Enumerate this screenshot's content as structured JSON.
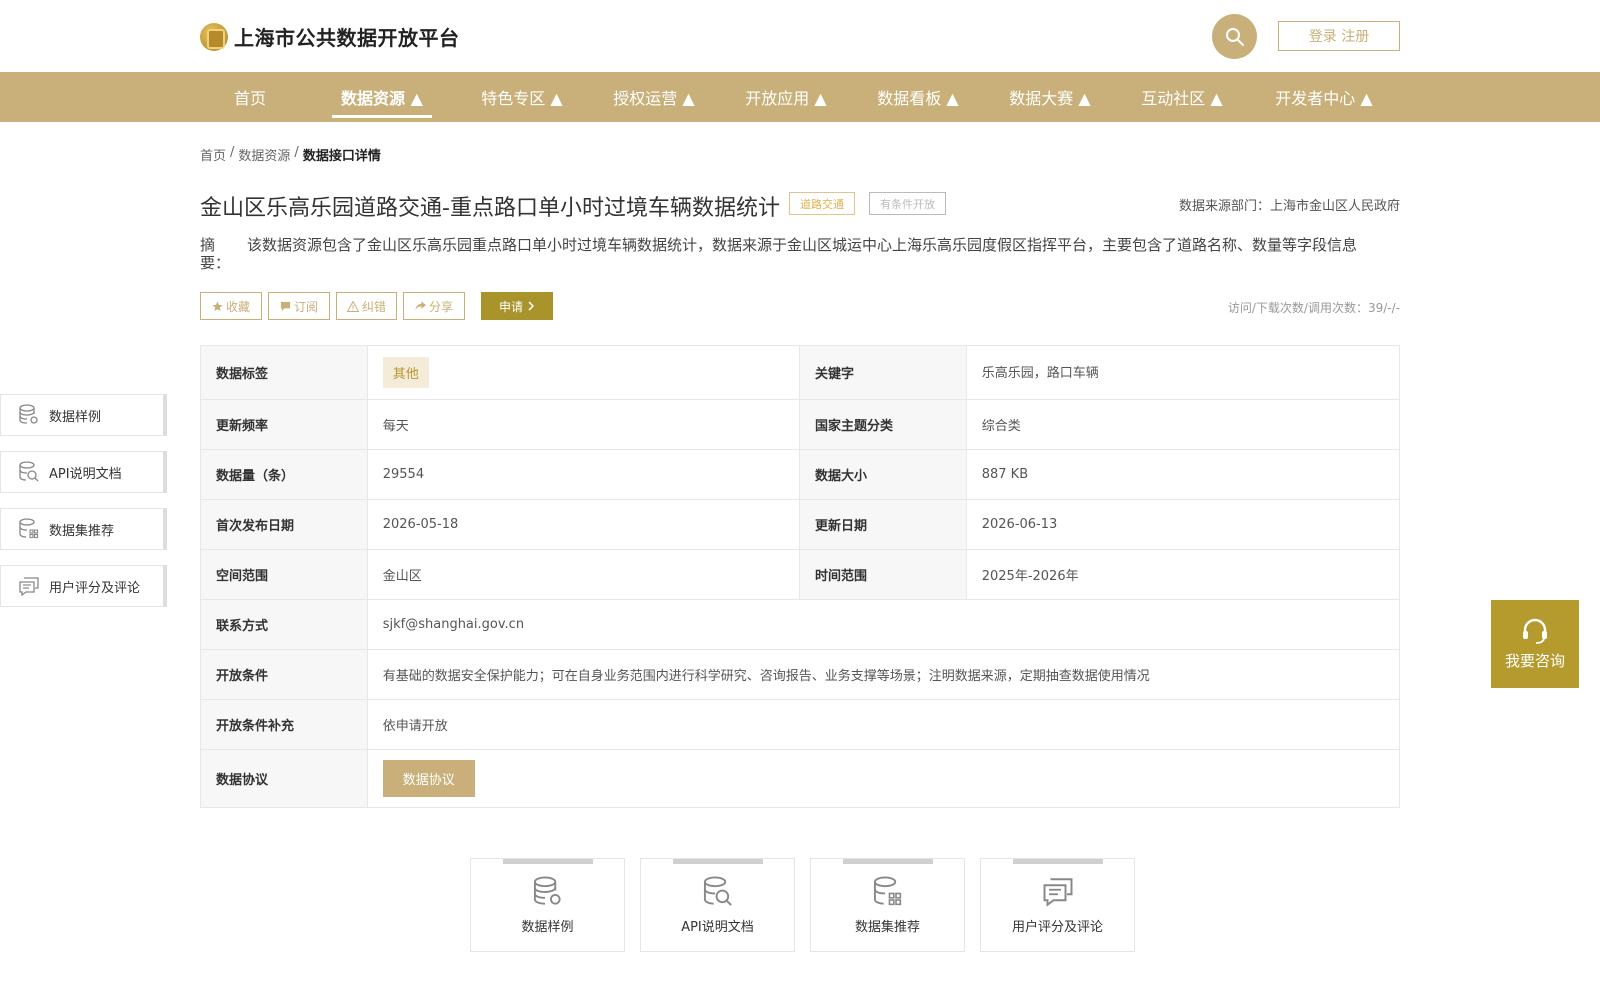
{
  "header": {
    "logo_text": "上海市公共数据开放平台",
    "login_label": "登录 注册"
  },
  "nav": {
    "items": [
      {
        "label": "首页"
      },
      {
        "label": "数据资源 ▲"
      },
      {
        "label": "特色专区 ▲"
      },
      {
        "label": "授权运营 ▲"
      },
      {
        "label": "开放应用 ▲"
      },
      {
        "label": "数据看板 ▲"
      },
      {
        "label": "数据大赛 ▲"
      },
      {
        "label": "互动社区 ▲"
      },
      {
        "label": "开发者中心 ▲"
      }
    ],
    "active_index": 1
  },
  "breadcrumb": {
    "home": "首页",
    "sep": "/",
    "resources": "数据资源",
    "current": "数据接口详情"
  },
  "dataset": {
    "title": "金山区乐高乐园道路交通-重点路口单小时过境车辆数据统计",
    "tag_category": "道路交通",
    "tag_open": "有条件开放",
    "source": "数据来源部门：上海市金山区人民政府",
    "abstract_label": "摘　要：",
    "abstract": "该数据资源包含了金山区乐高乐园重点路口单小时过境车辆数据统计，数据来源于金山区城运中心上海乐高乐园度假区指挥平台，主要包含了道路名称、数量等字段信息"
  },
  "actions": {
    "favorite": "收藏",
    "subscribe": "订阅",
    "report": "纠错",
    "share": "分享",
    "apply": "申请",
    "visits": "访问/下载次数/调用次数：39/-/-"
  },
  "table": {
    "r1": {
      "l1": "数据标签",
      "v1": "其他",
      "l2": "关键字",
      "v2": "乐高乐园，路口车辆"
    },
    "r2": {
      "l1": "更新频率",
      "v1": "每天",
      "l2": "国家主题分类",
      "v2": "综合类"
    },
    "r3": {
      "l1": "数据量（条）",
      "v1": "29554",
      "l2": "数据大小",
      "v2": "887 KB"
    },
    "r4": {
      "l1": "首次发布日期",
      "v1": "2026-05-18",
      "l2": "更新日期",
      "v2": "2026-06-13"
    },
    "r5": {
      "l1": "空间范围",
      "v1": "金山区",
      "l2": "时间范围",
      "v2": "2025年-2026年"
    },
    "r6": {
      "l1": "联系方式",
      "v1": "sjkf@shanghai.gov.cn"
    },
    "r7": {
      "l1": "开放条件",
      "v1": "有基础的数据安全保护能力；可在自身业务范围内进行科学研究、咨询报告、业务支撑等场景；注明数据来源，定期抽查数据使用情况"
    },
    "r8": {
      "l1": "开放条件补充",
      "v1": "依申请开放"
    },
    "r9": {
      "l1": "数据协议",
      "button": "数据协议"
    }
  },
  "sidebar": {
    "items": [
      {
        "label": "数据样例",
        "icon": "database-gear-icon"
      },
      {
        "label": "API说明文档",
        "icon": "document-search-icon"
      },
      {
        "label": "数据集推荐",
        "icon": "database-grid-icon"
      },
      {
        "label": "用户评分及评论",
        "icon": "comment-icon"
      }
    ]
  },
  "consult": {
    "label": "我要咨询"
  },
  "cards": {
    "items": [
      {
        "label": "数据样例"
      },
      {
        "label": "API说明文档"
      },
      {
        "label": "数据集推荐"
      },
      {
        "label": "用户评分及评论"
      }
    ]
  },
  "colors": {
    "brand": "#c9b07a",
    "apply": "#a8942a",
    "consult": "#b59a2e"
  }
}
